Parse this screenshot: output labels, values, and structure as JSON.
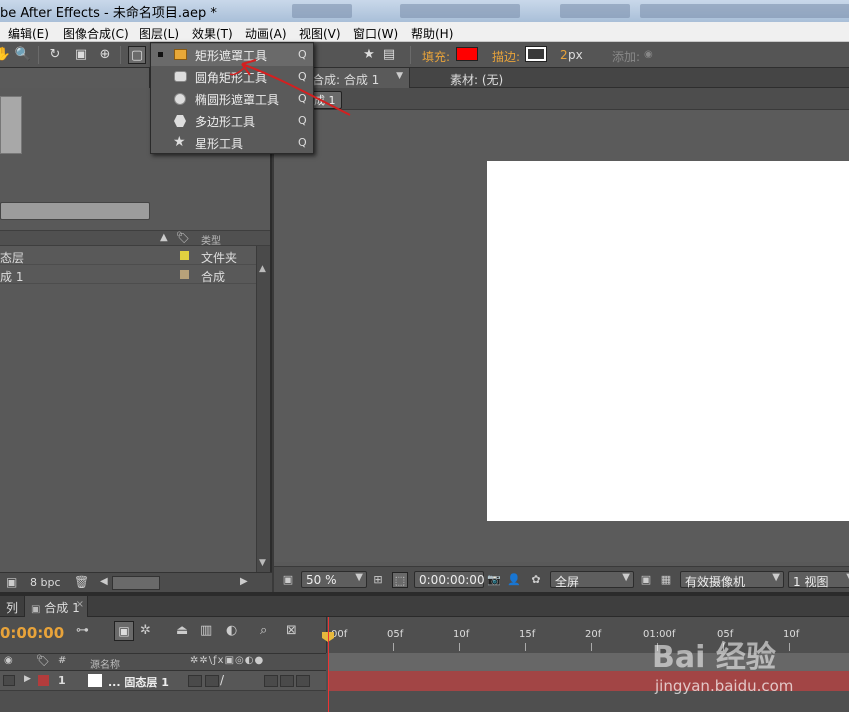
{
  "window": {
    "title": "be After Effects - 未命名项目.aep *"
  },
  "menu": [
    "编辑(E)",
    "图像合成(C)",
    "图层(L)",
    "效果(T)",
    "动画(A)",
    "视图(V)",
    "窗口(W)",
    "帮助(H)"
  ],
  "toolbar": {
    "fill_label": "填充:",
    "stroke_label": "描边:",
    "stroke_width": "2",
    "stroke_unit": "px",
    "add_label": "添加:",
    "fill_color": "#ff0000",
    "stroke_color": "#ffffff"
  },
  "tool_dropdown": {
    "items": [
      {
        "label": "矩形遮罩工具",
        "key": "Q",
        "icon": "rectangle-icon",
        "selected": true
      },
      {
        "label": "圆角矩形工具",
        "key": "Q",
        "icon": "rounded-rectangle-icon",
        "selected": false
      },
      {
        "label": "椭圆形遮罩工具",
        "key": "Q",
        "icon": "ellipse-icon",
        "selected": false
      },
      {
        "label": "多边形工具",
        "key": "Q",
        "icon": "polygon-icon",
        "selected": false
      },
      {
        "label": "星形工具",
        "key": "Q",
        "icon": "star-icon",
        "selected": false
      }
    ]
  },
  "project": {
    "type_header": "类型",
    "rows": [
      {
        "name": "态层",
        "type": "文件夹",
        "color": "#e0d040"
      },
      {
        "name": "成 1",
        "type": "合成",
        "color": "#b8a27a"
      }
    ],
    "bpc": "8 bpc"
  },
  "viewer": {
    "tab_comp": "合成: 合成 1",
    "tab_footage": "素材: (无)",
    "breadcrumb": "成 1",
    "zoom": "50 %",
    "timecode": "0:00:00:00",
    "resolution": "全屏",
    "camera": "有效摄像机",
    "views": "1 视图"
  },
  "timeline": {
    "tab_queue": "列",
    "tab_comp": "合成 1",
    "current_time": "0:00:00",
    "layer_name_header": "源名称",
    "ruler_labels": [
      "00f",
      "05f",
      "10f",
      "15f",
      "20f",
      "01:00f",
      "05f",
      "10f"
    ],
    "layer": {
      "number": "1",
      "name": "... 固态层 1"
    }
  },
  "watermark": {
    "logo": "Bai 经验",
    "url": "jingyan.baidu.com"
  }
}
